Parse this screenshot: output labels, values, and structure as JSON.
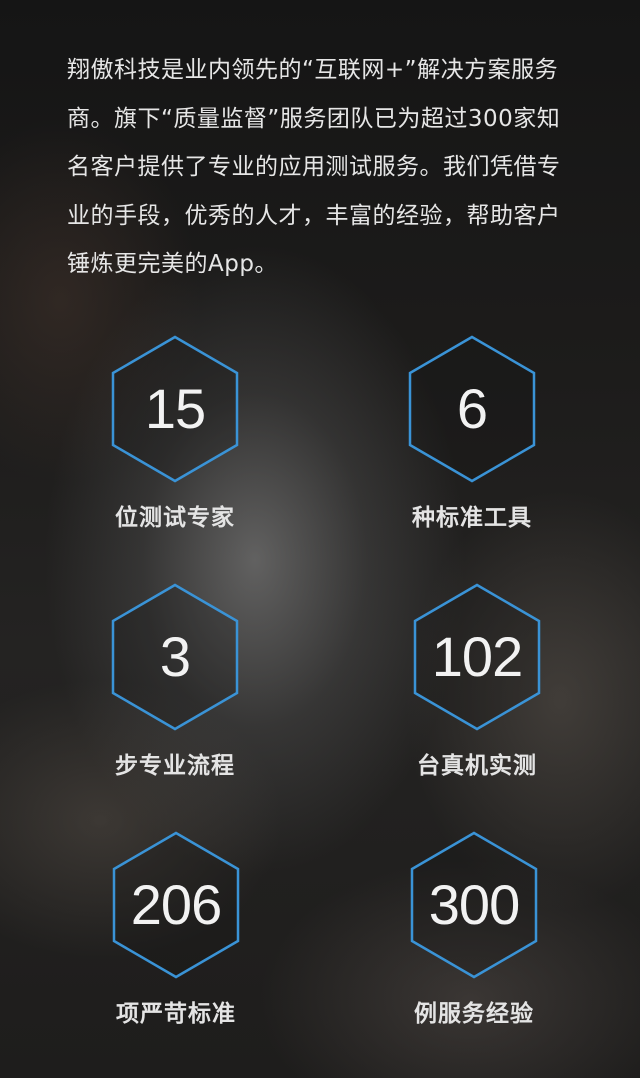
{
  "intro": {
    "text": "翔傲科技是业内领先的“互联网+”解决方案服务商。旗下“质量监督”服务团队已为超过300家知名客户提供了专业的应用测试服务。我们凭借专业的手段，优秀的人才，丰富的经验，帮助客户锤炼更完美的App。"
  },
  "colors": {
    "hex_stroke": "#3a93d6",
    "background": "#1d1c1b"
  },
  "stats": [
    {
      "value": "15",
      "label": "位测试专家",
      "icon": "hexagon-icon"
    },
    {
      "value": "6",
      "label": "种标准工具",
      "icon": "hexagon-icon"
    },
    {
      "value": "3",
      "label": "步专业流程",
      "icon": "hexagon-icon"
    },
    {
      "value": "102",
      "label": "台真机实测",
      "icon": "hexagon-icon"
    },
    {
      "value": "206",
      "label": "项严苛标准",
      "icon": "hexagon-icon"
    },
    {
      "value": "300",
      "label": "例服务经验",
      "icon": "hexagon-icon"
    }
  ]
}
